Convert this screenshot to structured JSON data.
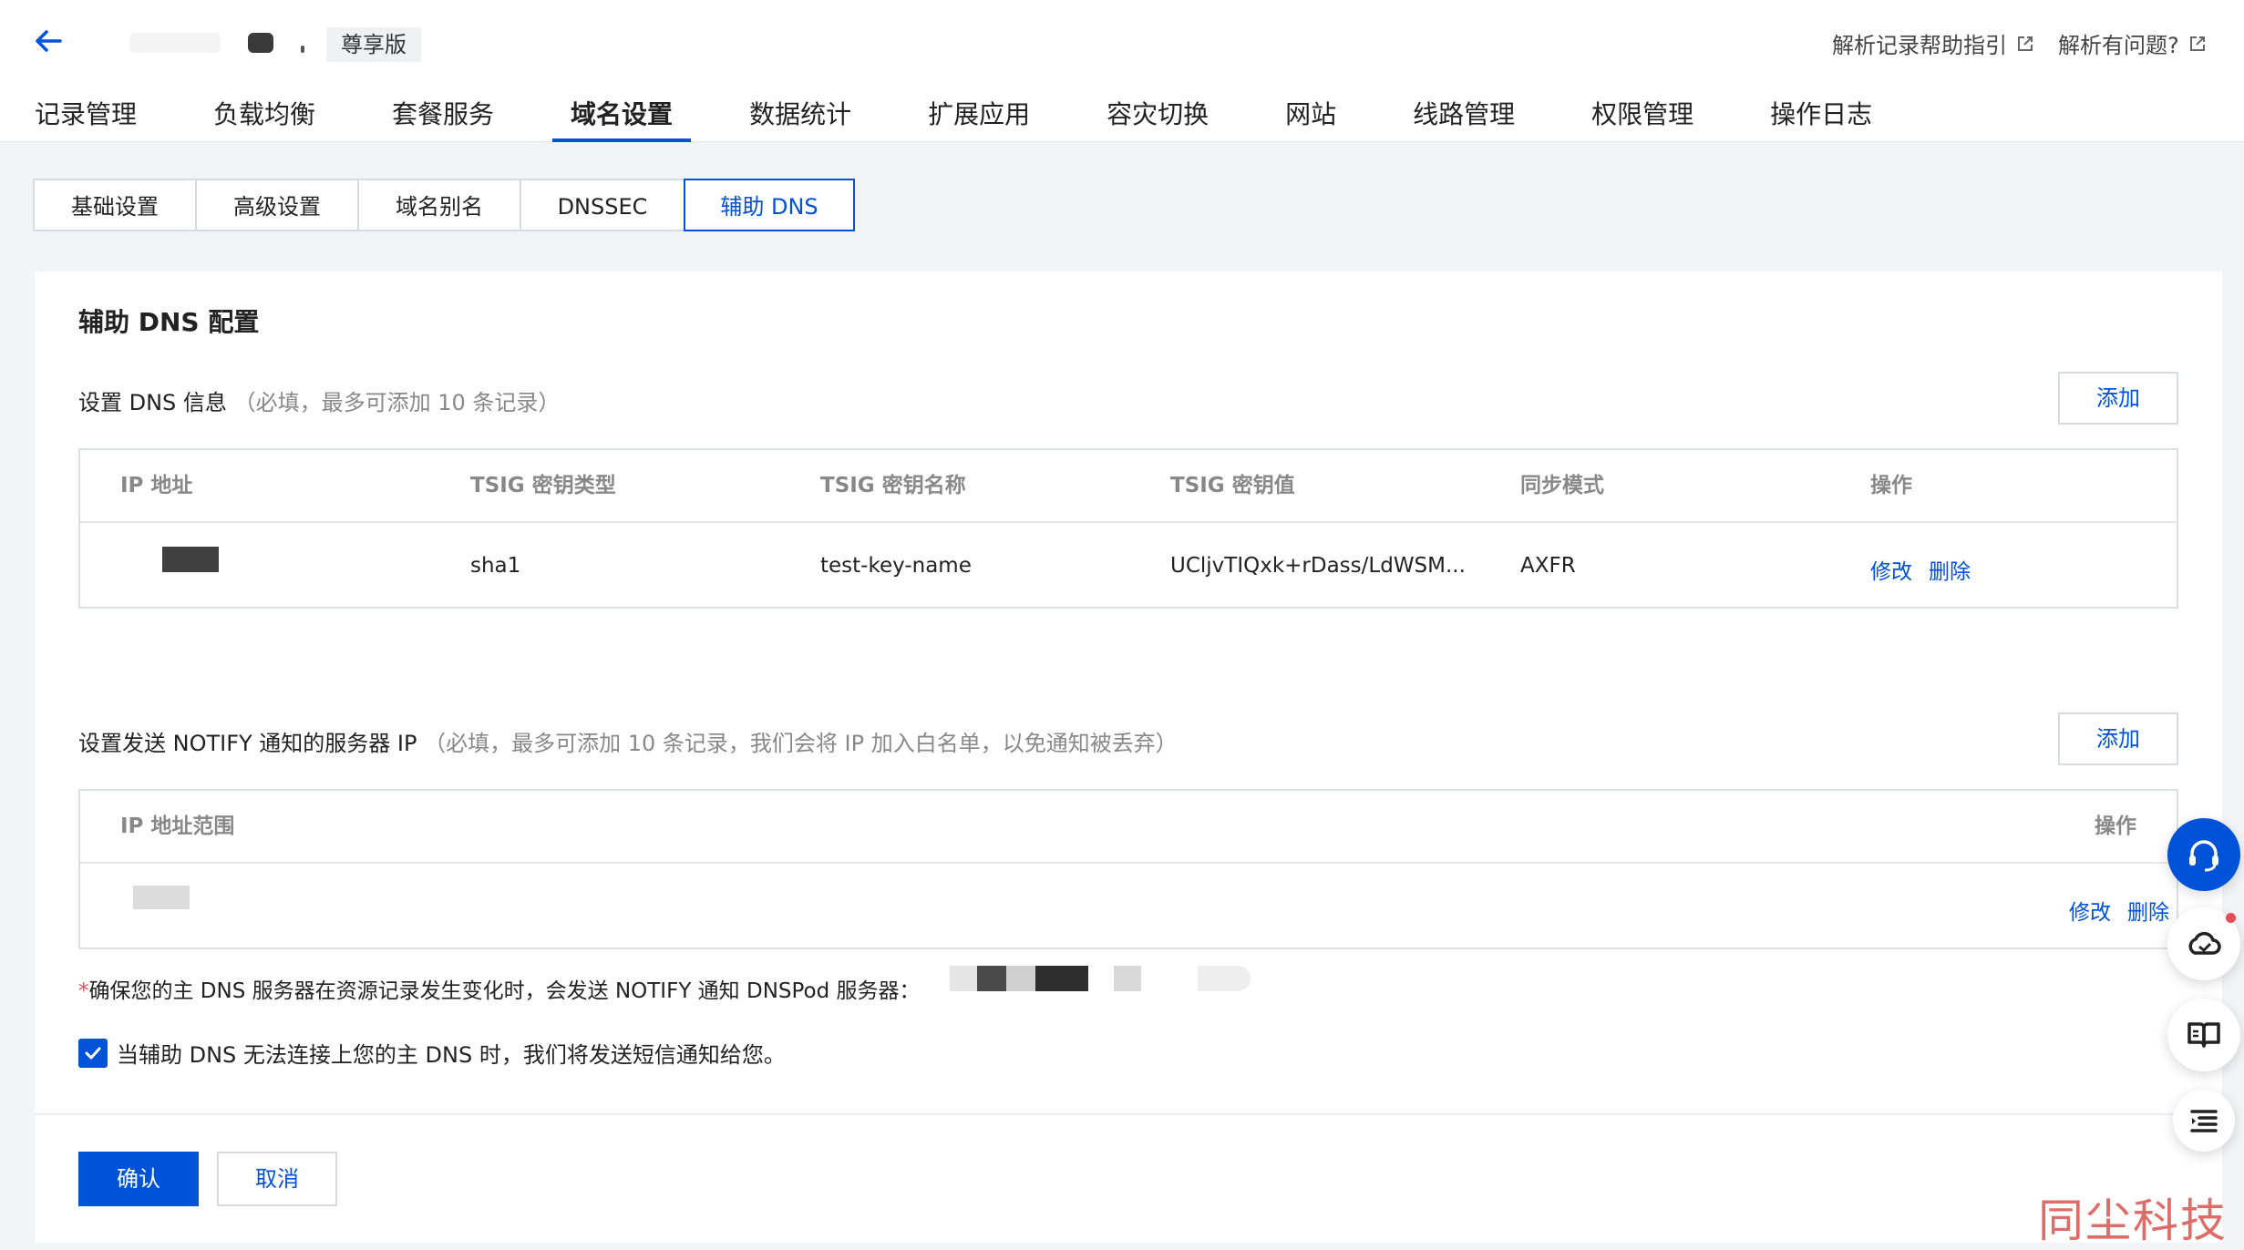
{
  "header": {
    "edition_badge": "尊享版",
    "help_link": "解析记录帮助指引",
    "issue_link": "解析有问题?"
  },
  "nav": {
    "items": [
      "记录管理",
      "负载均衡",
      "套餐服务",
      "域名设置",
      "数据统计",
      "扩展应用",
      "容灾切换",
      "网站",
      "线路管理",
      "权限管理",
      "操作日志"
    ],
    "active": "域名设置"
  },
  "subtabs": {
    "items": [
      "基础设置",
      "高级设置",
      "域名别名",
      "DNSSEC",
      "辅助 DNS"
    ],
    "active": "辅助 DNS"
  },
  "card": {
    "title": "辅助 DNS 配置",
    "dns_section": {
      "label": "设置 DNS 信息",
      "hint": "（必填，最多可添加 10 条记录）",
      "add_button": "添加",
      "columns": [
        "IP 地址",
        "TSIG 密钥类型",
        "TSIG 密钥名称",
        "TSIG 密钥值",
        "同步模式",
        "操作"
      ],
      "rows": [
        {
          "key_type": "sha1",
          "key_name": "test-key-name",
          "key_value": "UCljvTIQxk+rDass/LdWSM...",
          "sync_mode": "AXFR",
          "edit": "修改",
          "delete": "删除"
        }
      ]
    },
    "notify_section": {
      "label": "设置发送 NOTIFY 通知的服务器 IP",
      "hint": "（必填，最多可添加 10 条记录，我们会将 IP 加入白名单，以免通知被丢弃）",
      "add_button": "添加",
      "columns": [
        "IP 地址范围",
        "操作"
      ],
      "rows": [
        {
          "edit": "修改",
          "delete": "删除"
        }
      ]
    },
    "notice_star": "*",
    "notice": "确保您的主 DNS 服务器在资源记录发生变化时，会发送 NOTIFY 通知 DNSPod 服务器：",
    "sms_checkbox": {
      "checked": true,
      "label": "当辅助 DNS 无法连接上您的主 DNS 时，我们将发送短信通知给您。"
    },
    "confirm_button": "确认",
    "cancel_button": "取消"
  },
  "floating": [
    "headset-icon",
    "cloud-icon",
    "book-icon",
    "list-icon"
  ],
  "watermark": "同尘科技",
  "colors": {
    "accent": "#0052d9",
    "danger": "#e34d59",
    "watermark": "#d9534f"
  }
}
